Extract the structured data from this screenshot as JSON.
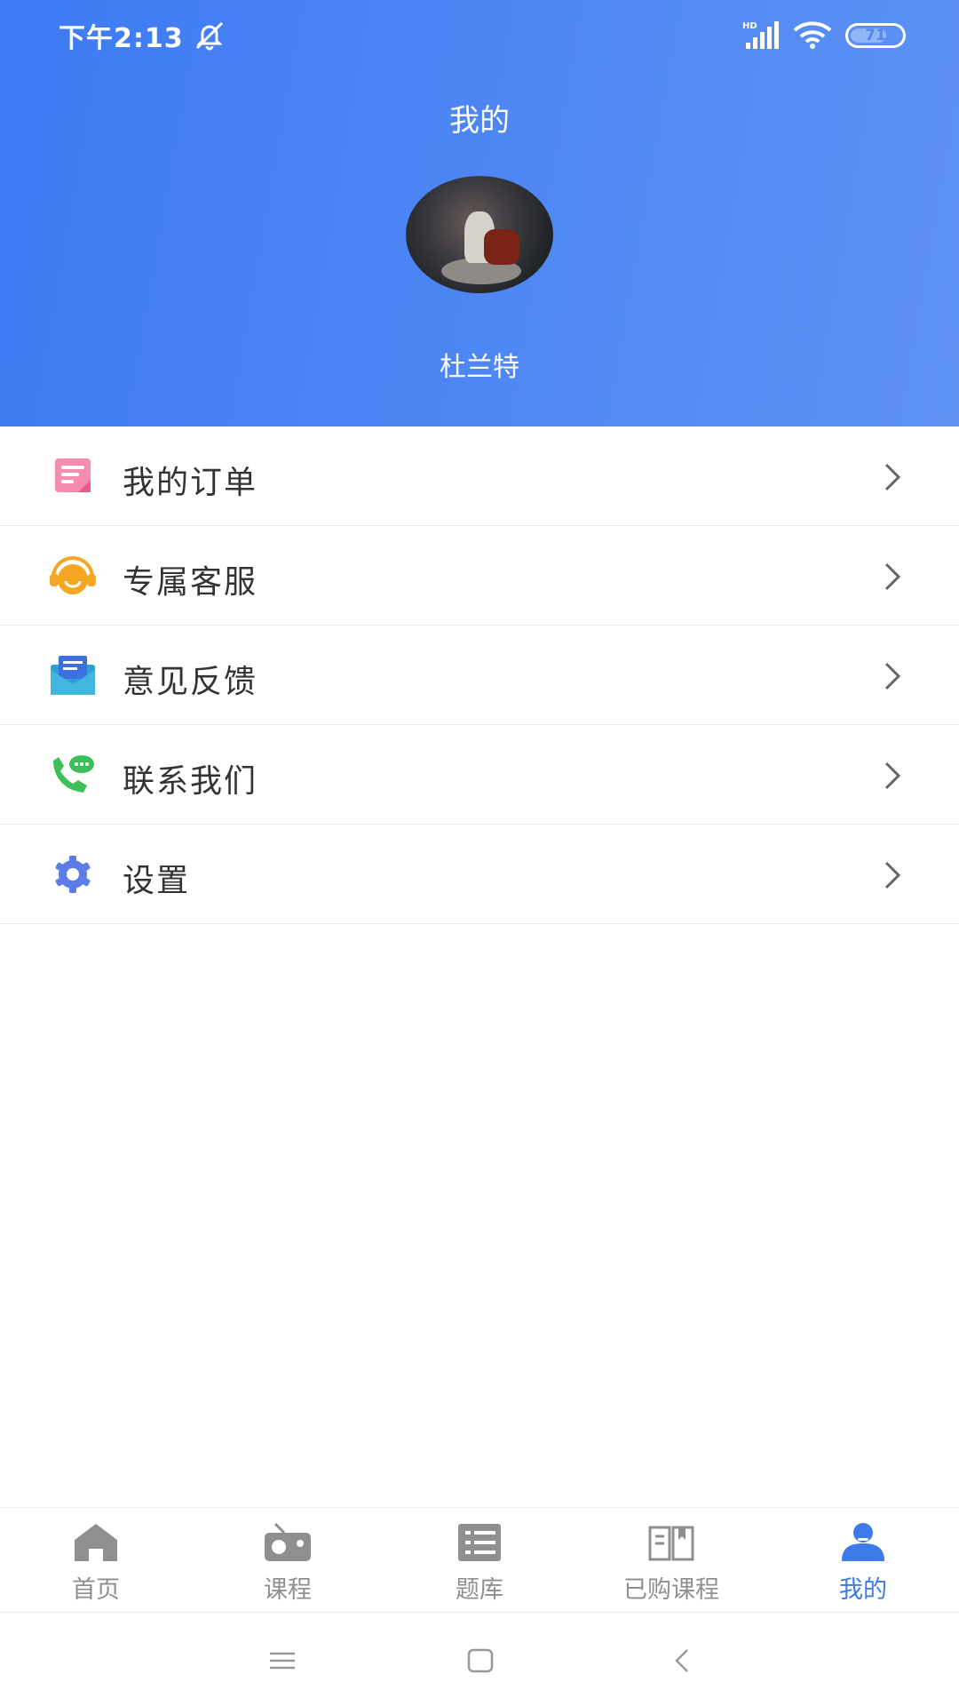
{
  "status": {
    "time": "下午2:13",
    "battery": "71",
    "battery_level": 0.71
  },
  "header": {
    "title": "我的",
    "user_name": "杜兰特"
  },
  "menu": {
    "items": [
      {
        "label": "我的订单",
        "icon": "order-icon",
        "color": "#f06a9a"
      },
      {
        "label": "专属客服",
        "icon": "headset-icon",
        "color": "#f5a623"
      },
      {
        "label": "意见反馈",
        "icon": "feedback-mail-icon",
        "color": "#3d8ae6"
      },
      {
        "label": "联系我们",
        "icon": "phone-chat-icon",
        "color": "#3fbf5a"
      },
      {
        "label": "设置",
        "icon": "gear-icon",
        "color": "#5c7ce8"
      }
    ]
  },
  "tabbar": {
    "tabs": [
      {
        "label": "首页",
        "icon": "home-icon",
        "active": false
      },
      {
        "label": "课程",
        "icon": "radio-icon",
        "active": false
      },
      {
        "label": "题库",
        "icon": "question-bank-icon",
        "active": false
      },
      {
        "label": "已购课程",
        "icon": "book-icon",
        "active": false
      },
      {
        "label": "我的",
        "icon": "profile-icon",
        "active": true
      }
    ],
    "active_color": "#3c7ae8",
    "inactive_color": "#8f8f8f"
  },
  "colors": {
    "header_blue": "#4f87f4"
  }
}
